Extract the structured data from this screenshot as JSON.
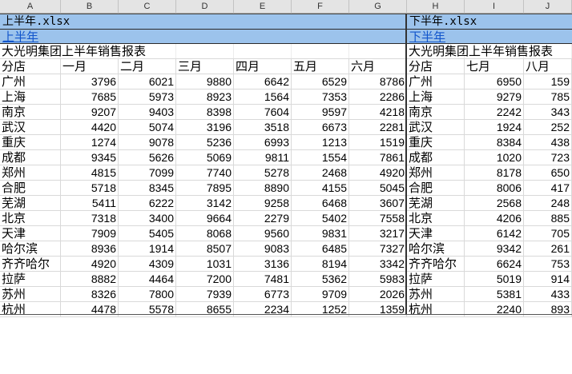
{
  "columns": [
    "A",
    "B",
    "C",
    "D",
    "E",
    "F",
    "G",
    "H",
    "I",
    "J"
  ],
  "left_pane": {
    "file_name": "上半年.xlsx",
    "sheet_name": "上半年",
    "title": "大光明集团上半年销售报表",
    "header_branch": "分店",
    "months": [
      "一月",
      "二月",
      "三月",
      "四月",
      "五月",
      "六月"
    ]
  },
  "right_pane": {
    "file_name": "下半年.xlsx",
    "sheet_name": "下半年",
    "title": "大光明集团上半年销售报表",
    "header_branch": "分店",
    "months": [
      "七月",
      "八月"
    ]
  },
  "rows": [
    {
      "branch": "广州",
      "h1": [
        "3796",
        "6021",
        "9880",
        "6642",
        "6529",
        "8786"
      ],
      "h2": [
        "6950",
        "159"
      ]
    },
    {
      "branch": "上海",
      "h1": [
        "7685",
        "5973",
        "8923",
        "1564",
        "7353",
        "2286"
      ],
      "h2": [
        "9279",
        "785"
      ]
    },
    {
      "branch": "南京",
      "h1": [
        "9207",
        "9403",
        "8398",
        "7604",
        "9597",
        "4218"
      ],
      "h2": [
        "2242",
        "343"
      ]
    },
    {
      "branch": "武汉",
      "h1": [
        "4420",
        "5074",
        "3196",
        "3518",
        "6673",
        "2281"
      ],
      "h2": [
        "1924",
        "252"
      ]
    },
    {
      "branch": "重庆",
      "h1": [
        "1274",
        "9078",
        "5236",
        "6993",
        "1213",
        "1519"
      ],
      "h2": [
        "8384",
        "438"
      ]
    },
    {
      "branch": "成都",
      "h1": [
        "9345",
        "5626",
        "5069",
        "9811",
        "1554",
        "7861"
      ],
      "h2": [
        "1020",
        "723"
      ]
    },
    {
      "branch": "郑州",
      "h1": [
        "4815",
        "7099",
        "7740",
        "5278",
        "2468",
        "4920"
      ],
      "h2": [
        "8178",
        "650"
      ]
    },
    {
      "branch": "合肥",
      "h1": [
        "5718",
        "8345",
        "7895",
        "8890",
        "4155",
        "5045"
      ],
      "h2": [
        "8006",
        "417"
      ]
    },
    {
      "branch": "芜湖",
      "h1": [
        "5411",
        "6222",
        "3142",
        "9258",
        "6468",
        "3607"
      ],
      "h2": [
        "2568",
        "248"
      ]
    },
    {
      "branch": "北京",
      "h1": [
        "7318",
        "3400",
        "9664",
        "2279",
        "5402",
        "7558"
      ],
      "h2": [
        "4206",
        "885"
      ]
    },
    {
      "branch": "天津",
      "h1": [
        "7909",
        "5405",
        "8068",
        "9560",
        "9831",
        "3217"
      ],
      "h2": [
        "6142",
        "705"
      ]
    },
    {
      "branch": "哈尔滨",
      "h1": [
        "8936",
        "1914",
        "8507",
        "9083",
        "6485",
        "7327"
      ],
      "h2": [
        "9342",
        "261"
      ]
    },
    {
      "branch": "齐齐哈尔",
      "h1": [
        "4920",
        "4309",
        "1031",
        "3136",
        "8194",
        "3342"
      ],
      "h2": [
        "6624",
        "753"
      ]
    },
    {
      "branch": "拉萨",
      "h1": [
        "8882",
        "4464",
        "7200",
        "7481",
        "5362",
        "5983"
      ],
      "h2": [
        "5019",
        "914"
      ]
    },
    {
      "branch": "苏州",
      "h1": [
        "8326",
        "7800",
        "7939",
        "6773",
        "9709",
        "2026"
      ],
      "h2": [
        "5381",
        "433"
      ]
    },
    {
      "branch": "杭州",
      "h1": [
        "4478",
        "5578",
        "8655",
        "2234",
        "1252",
        "1359"
      ],
      "h2": [
        "2240",
        "893"
      ]
    }
  ],
  "colors": {
    "band": "#9cc3ec",
    "link": "#1155cc",
    "header_bg": "#e4e4e4"
  }
}
